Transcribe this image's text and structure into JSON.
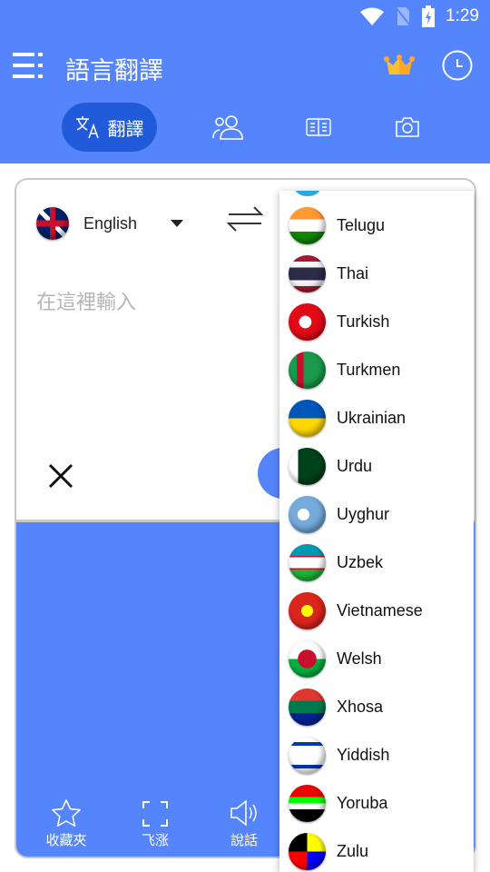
{
  "status": {
    "time": "1:29",
    "icons": [
      "wifi-icon",
      "no-sim-icon",
      "battery-charging-icon"
    ]
  },
  "appbar": {
    "title": "語言翻譯",
    "icons": [
      "menu-icon",
      "crown-icon",
      "history-icon"
    ]
  },
  "tabs": [
    {
      "label": "翻譯",
      "icon": "translate-icon",
      "active": true
    },
    {
      "icon": "conversation-icon"
    },
    {
      "icon": "phrasebook-icon"
    },
    {
      "icon": "camera-icon"
    }
  ],
  "source": {
    "language": "English",
    "placeholder": "在這裡輸入"
  },
  "actions": [
    {
      "label": "收藏夾",
      "icon": "star-icon"
    },
    {
      "label": "飞涨",
      "icon": "fullscreen-icon"
    },
    {
      "label": "說話",
      "icon": "speaker-icon"
    }
  ],
  "colors": {
    "primary": "#5585fd",
    "active_tab": "#225bd9"
  },
  "dropdown": {
    "items": [
      {
        "label": "Telugu",
        "flag": "linear-gradient(#f93 0 33%,#fff 33% 66%,#128807 66%)"
      },
      {
        "label": "Thai",
        "flag": "linear-gradient(#a51931 0 17%,#f4f5f8 17% 33%,#2d2a4a 33% 67%,#f4f5f8 67% 83%,#a51931 83%)"
      },
      {
        "label": "Turkish",
        "flag": "radial-gradient(circle at 45% 50%,#fff 0 22%,#e30a17 23%)"
      },
      {
        "label": "Turkmen",
        "flag": "linear-gradient(90deg,#1a9a4a 0 22%,#c8102e 22% 40%,#1a9a4a 40%)"
      },
      {
        "label": "Ukrainian",
        "flag": "linear-gradient(#0057b7 0 50%,#ffd700 50%)"
      },
      {
        "label": "Urdu",
        "flag": "linear-gradient(90deg,#fff 0 25%,#01411c 25%)"
      },
      {
        "label": "Uyghur",
        "flag": "radial-gradient(circle at 40% 50%,#fff 0 20%,#75aadb 21%)"
      },
      {
        "label": "Uzbek",
        "flag": "linear-gradient(#0099b5 0 32%,#ce1126 32% 35%,#fff 35% 65%,#ce1126 65% 68%,#1eb53a 68%)"
      },
      {
        "label": "Vietnamese",
        "flag": "radial-gradient(circle,#ff0 0 22%,#da251d 23%)"
      },
      {
        "label": "Welsh",
        "flag": "radial-gradient(circle,#c8102e 0 35%,transparent 36%),linear-gradient(#fff 0 50%,#00b140 50%)"
      },
      {
        "label": "Xhosa",
        "flag": "linear-gradient(#de3831 0 33%,#007a4d 33% 66%,#002395 66%)"
      },
      {
        "label": "Yiddish",
        "flag": "linear-gradient(#fff 0 15%,#0038b8 15% 25%,#fff 25% 75%,#0038b8 75% 85%,#fff 85%)"
      },
      {
        "label": "Yoruba",
        "flag": "linear-gradient(#e00 0 33%,#0f0 33% 50%,#fff 50% 66%,#000 66%)"
      },
      {
        "label": "Zulu",
        "flag": "conic-gradient(#ff0 0 25%,#00f 25% 50%,#f00 50% 75%,#000 75%)"
      }
    ]
  }
}
